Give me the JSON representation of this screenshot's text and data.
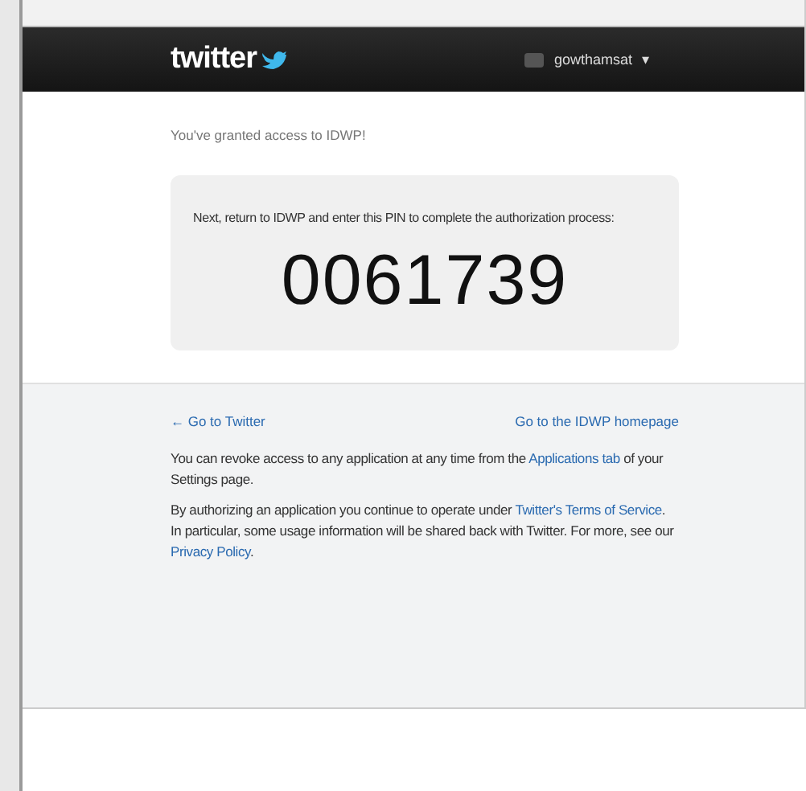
{
  "header": {
    "logo": "twitter",
    "username": "gowthamsat",
    "menu_caret": "▾"
  },
  "granted": "You've granted access to IDWP!",
  "pin_box": {
    "instruction": "Next, return to IDWP and enter this PIN to complete the authorization process:",
    "pin": "0061739"
  },
  "links": {
    "back": "← Go to Twitter",
    "home": "Go to the IDWP homepage"
  },
  "paragraphs": [
    [
      {
        "text": "You can revoke access to any application at any time from the ",
        "link": false
      },
      {
        "text": "Applications tab",
        "link": true
      },
      {
        "text": " of your Settings page.",
        "link": false
      }
    ],
    [
      {
        "text": "By authorizing an application you continue to operate under ",
        "link": false
      },
      {
        "text": "Twitter's Terms of Service",
        "link": true
      },
      {
        "text": ". In particular, some usage information will be shared back with Twitter. For more, see our ",
        "link": false
      },
      {
        "text": "Privacy Policy",
        "link": true
      },
      {
        "text": ".",
        "link": false
      }
    ]
  ]
}
